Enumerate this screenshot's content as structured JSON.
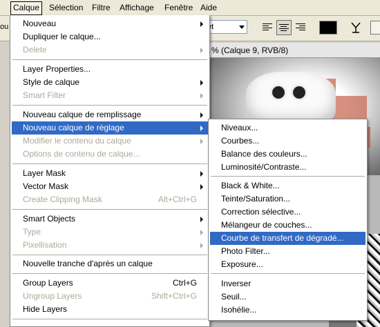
{
  "menubar": {
    "items": [
      "Calque",
      "Sélection",
      "Filtre",
      "Affichage",
      "Fenêtre",
      "Aide"
    ]
  },
  "toolbar": {
    "left_fragment": "out",
    "font_select_value": "et",
    "text_color": "#000000"
  },
  "document": {
    "title": "% (Calque 9, RVB/8)"
  },
  "menu": {
    "items": [
      {
        "label": "Nouveau",
        "submenu": true,
        "enabled": true
      },
      {
        "label": "Dupliquer le calque...",
        "enabled": true
      },
      {
        "label": "Delete",
        "submenu": true,
        "enabled": false
      },
      {
        "label": "Layer Properties...",
        "enabled": true
      },
      {
        "label": "Style de calque",
        "submenu": true,
        "enabled": true
      },
      {
        "label": "Smart Filter",
        "submenu": true,
        "enabled": false
      },
      {
        "label": "Nouveau calque de remplissage",
        "submenu": true,
        "enabled": true
      },
      {
        "label": "Nouveau calque de réglage",
        "submenu": true,
        "enabled": true,
        "highlighted": true
      },
      {
        "label": "Modifier le contenu du calque",
        "submenu": true,
        "enabled": false
      },
      {
        "label": "Options de contenu de calque...",
        "enabled": false
      },
      {
        "label": "Layer Mask",
        "submenu": true,
        "enabled": true
      },
      {
        "label": "Vector Mask",
        "submenu": true,
        "enabled": true
      },
      {
        "label": "Create Clipping Mask",
        "shortcut": "Alt+Ctrl+G",
        "enabled": false
      },
      {
        "label": "Smart Objects",
        "submenu": true,
        "enabled": true
      },
      {
        "label": "Type",
        "submenu": true,
        "enabled": false
      },
      {
        "label": "Pixellisation",
        "submenu": true,
        "enabled": false
      },
      {
        "label": "Nouvelle tranche d'après un calque",
        "enabled": true
      },
      {
        "label": "Group Layers",
        "shortcut": "Ctrl+G",
        "enabled": true
      },
      {
        "label": "Ungroup Layers",
        "shortcut": "Shift+Ctrl+G",
        "enabled": false
      },
      {
        "label": "Hide Layers",
        "enabled": true
      }
    ]
  },
  "submenu": {
    "items": [
      {
        "label": "Niveaux..."
      },
      {
        "label": "Courbes..."
      },
      {
        "label": "Balance des couleurs..."
      },
      {
        "label": "Luminosité/Contraste..."
      },
      {
        "label": "Black & White..."
      },
      {
        "label": "Teinte/Saturation..."
      },
      {
        "label": "Correction sélective..."
      },
      {
        "label": "Mélangeur de couches..."
      },
      {
        "label": "Courbe de transfert de dégradé...",
        "highlighted": true
      },
      {
        "label": "Photo Filter..."
      },
      {
        "label": "Exposure..."
      },
      {
        "label": "Inverser"
      },
      {
        "label": "Seuil..."
      },
      {
        "label": "Isohélie..."
      }
    ]
  },
  "colors": {
    "highlight": "#316ac5",
    "disabled_text": "#aca899"
  }
}
